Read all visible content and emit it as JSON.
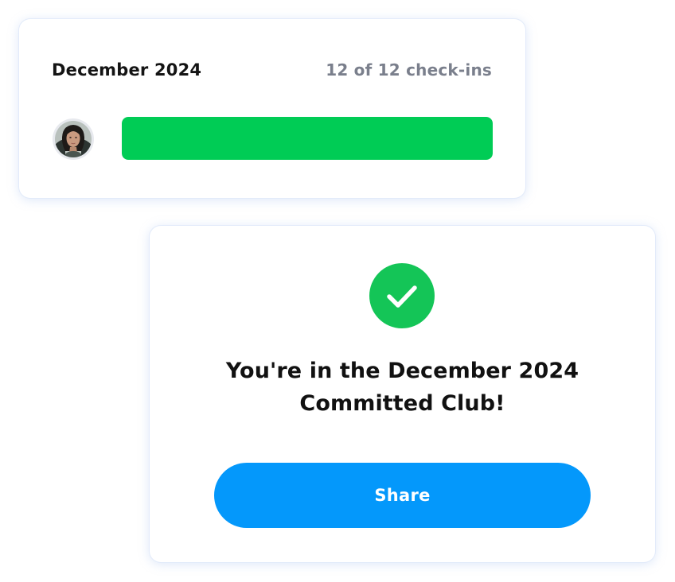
{
  "progress_card": {
    "month_title": "December 2024",
    "checkin_count": "12 of 12 check-ins",
    "progress_fraction": 1.0,
    "avatar_icon": "user-avatar-photo"
  },
  "club_card": {
    "icon": "checkmark-icon",
    "message_line1": "You're in the December 2024",
    "message_line2": "Committed Club!",
    "share_label": "Share"
  },
  "colors": {
    "progress_green": "#00CC55",
    "check_green": "#14C557",
    "share_blue": "#0498FB",
    "muted_text": "#7A7F8C"
  }
}
